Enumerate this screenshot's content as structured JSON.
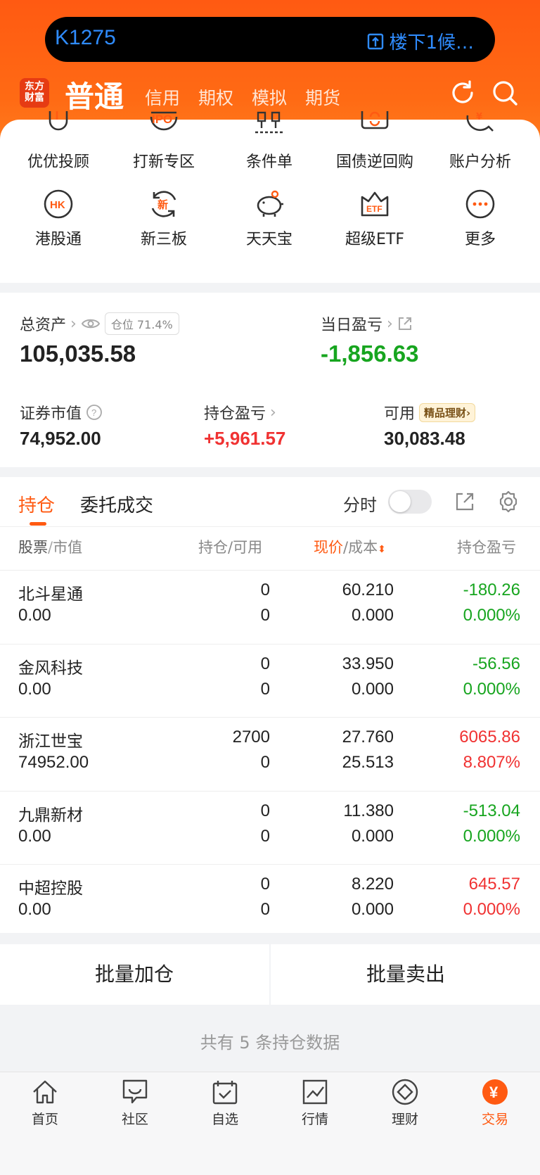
{
  "status_bar": {
    "left_text": "K1275",
    "right_text": "楼下1候…"
  },
  "nav": {
    "logo_line1": "东方",
    "logo_line2": "财富",
    "current": "普通",
    "tabs": [
      "信用",
      "期权",
      "模拟",
      "期货"
    ]
  },
  "quick_grid": {
    "row1": [
      "优优投顾",
      "打新专区",
      "条件单",
      "国债逆回购",
      "账户分析"
    ],
    "row2": [
      "港股通",
      "新三板",
      "天天宝",
      "超级ETF",
      "更多"
    ],
    "icons_row1": [
      "advisor-icon",
      "ipo-icon",
      "condition-order-icon",
      "repo-icon",
      "analysis-icon"
    ],
    "icons_row2": [
      "hk-icon",
      "neeq-icon",
      "piggy-bank-icon",
      "etf-icon",
      "more-icon"
    ],
    "ipo_text": "IPO",
    "hk_text": "HK",
    "neeq_text": "新",
    "etf_text": "ETF"
  },
  "assets": {
    "total_label": "总资产",
    "position_badge": "仓位 71.4%",
    "total_value": "105,035.58",
    "daily_label": "当日盈亏",
    "daily_value": "-1,856.63",
    "market_label": "证券市值",
    "market_value": "74,952.00",
    "holding_pl_label": "持仓盈亏",
    "holding_pl_value": "+5,961.57",
    "available_label": "可用",
    "wealth_badge": "精品理财",
    "available_value": "30,083.48"
  },
  "holdings": {
    "tab_active": "持仓",
    "tab_other": "委托成交",
    "fenshi_label": "分时",
    "col_stock": "股票",
    "col_mv": "市值",
    "col_hold": "持仓",
    "col_avail": "可用",
    "col_price": "现价",
    "col_cost": "成本",
    "col_pl": "持仓盈亏",
    "slash": "/",
    "rows": [
      {
        "name": "北斗星通",
        "mv": "0.00",
        "hold": "0",
        "avail": "0",
        "price": "60.210",
        "cost": "0.000",
        "pl": "-180.26",
        "pct": "0.000%",
        "pl_color": "green",
        "pct_color": "green"
      },
      {
        "name": "金风科技",
        "mv": "0.00",
        "hold": "0",
        "avail": "0",
        "price": "33.950",
        "cost": "0.000",
        "pl": "-56.56",
        "pct": "0.000%",
        "pl_color": "green",
        "pct_color": "green"
      },
      {
        "name": "浙江世宝",
        "mv": "74952.00",
        "hold": "2700",
        "avail": "0",
        "price": "27.760",
        "cost": "25.513",
        "pl": "6065.86",
        "pct": "8.807%",
        "pl_color": "red",
        "pct_color": "red"
      },
      {
        "name": "九鼎新材",
        "mv": "0.00",
        "hold": "0",
        "avail": "0",
        "price": "11.380",
        "cost": "0.000",
        "pl": "-513.04",
        "pct": "0.000%",
        "pl_color": "green",
        "pct_color": "green"
      },
      {
        "name": "中超控股",
        "mv": "0.00",
        "hold": "0",
        "avail": "0",
        "price": "8.220",
        "cost": "0.000",
        "pl": "645.57",
        "pct": "0.000%",
        "pl_color": "red",
        "pct_color": "red"
      }
    ]
  },
  "actions": {
    "batch_add": "批量加仓",
    "batch_sell": "批量卖出"
  },
  "footer_note": "共有 5 条持仓数据",
  "tabbar": [
    {
      "label": "首页",
      "icon": "home-icon"
    },
    {
      "label": "社区",
      "icon": "community-icon"
    },
    {
      "label": "自选",
      "icon": "watchlist-icon"
    },
    {
      "label": "行情",
      "icon": "market-icon"
    },
    {
      "label": "理财",
      "icon": "wealth-icon"
    },
    {
      "label": "交易",
      "icon": "trade-icon"
    }
  ],
  "tabbar_trade_glyph": "¥",
  "colors": {
    "accent": "#ff5a12",
    "up": "#f03232",
    "down": "#17a51f"
  }
}
